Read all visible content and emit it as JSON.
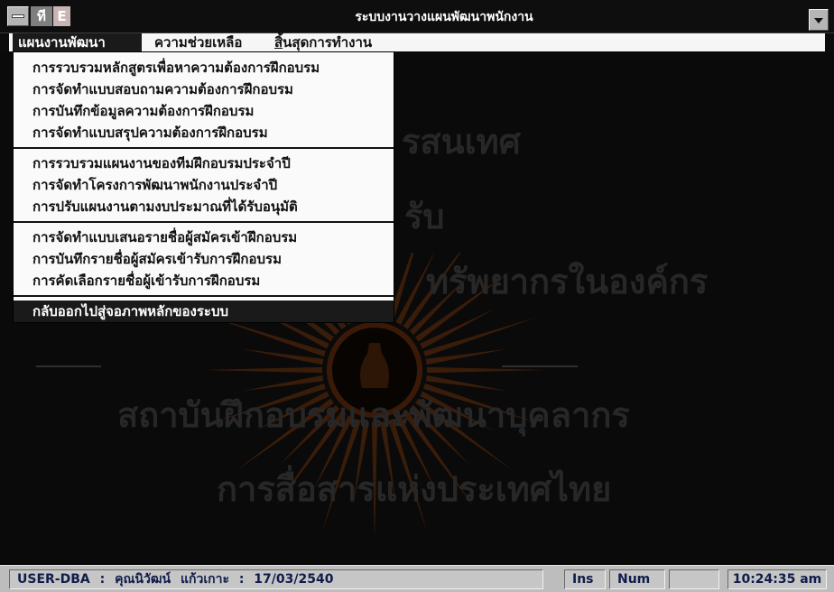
{
  "window": {
    "title": "ระบบงานวางแผนพัฒนาพนักงาน",
    "app_icon": {
      "glyph_left": "ที",
      "glyph_right": "E"
    },
    "system_menu_icon": "system-menu-icon",
    "minimize_icon": "down-arrow-icon"
  },
  "menubar": {
    "items": [
      {
        "label": "แผนงานพัฒนา",
        "state": "open"
      },
      {
        "label": "ความช่วยเหลือ"
      },
      {
        "accelerator": "สิ้",
        "rest": "นสุดการทำงาน"
      }
    ]
  },
  "dropdown": {
    "items": [
      {
        "label": "การรวบรวมหลักสูตรเพื่อหาความต้องการฝึกอบรม"
      },
      {
        "label": "การจัดทำแบบสอบถามความต้องการฝึกอบรม"
      },
      {
        "label": "การบันทึกข้อมูลความต้องการฝึกอบรม"
      },
      {
        "label": "การจัดทำแบบสรุปความต้องการฝึกอบรม"
      },
      {
        "label": "การรวบรวมแผนงานของทีมฝึกอบรมประจำปี"
      },
      {
        "label": "การจัดทำโครงการพัฒนาพนักงานประจำปี"
      },
      {
        "label": "การปรับแผนงานตามงบประมาณที่ได้รับอนุมัติ"
      },
      {
        "label": "การจัดทำแบบเสนอรายชื่อผู้สมัครเข้าฝึกอบรม"
      },
      {
        "label": "การบันทึกรายชื่อผู้สมัครเข้ารับการฝึกอบรม"
      },
      {
        "label": "การคัดเลือกรายชื่อผู้เข้ารับการฝึกอบรม"
      },
      {
        "label": "กลับออกไปสู่จอภาพหลักของระบบ",
        "highlighted": true
      }
    ]
  },
  "main_screen": {
    "background_lines": [
      "รสนเทศ",
      "รับ",
      "ทรัพยากรในองค์กร",
      "สถาบันฝึกอบรมและพัฒนาบุคลากร",
      "การสื่อสารแห่งประเทศไทย"
    ],
    "watermark_icon": "sunburst-emblem-icon"
  },
  "statusbar": {
    "user_info": "USER-DBA : คุณนิวัฒน์ แก้วเกาะ : 17/03/2540",
    "ins": "Ins",
    "num": "Num",
    "time": "10:24:35 am"
  },
  "colors": {
    "titlebar_bg": "#0e0e0e",
    "menu_highlight_bg": "#1a1a1a",
    "menu_bg": "#f6f6f6",
    "screen_bg": "#0a0a0a",
    "statusbar_bg": "#bdbdbd",
    "status_text": "#101c4a",
    "watermark": "#4a2309"
  }
}
